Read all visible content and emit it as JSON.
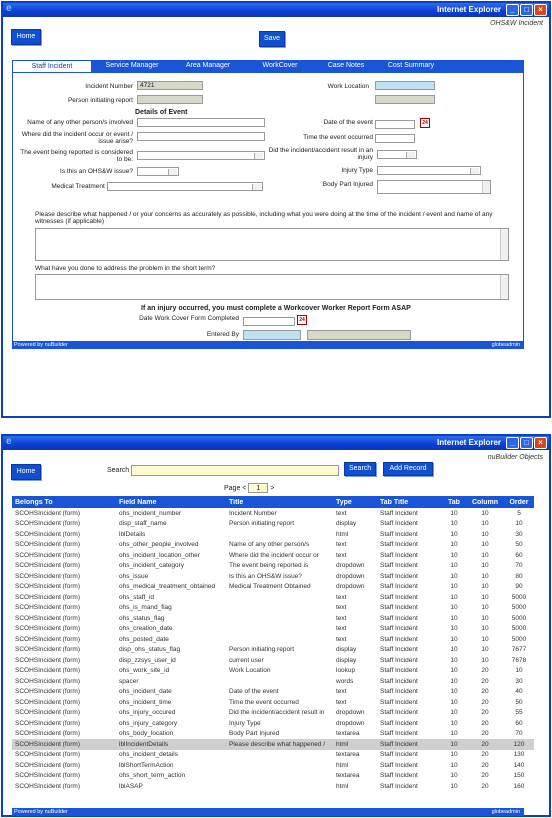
{
  "win1": {
    "title": "Internet Explorer",
    "subtitle": "OHS&W Incident",
    "home": "Home",
    "save": "Save",
    "tabs": [
      "Staff Incident",
      "Service Manager",
      "Area Manager",
      "WorkCover",
      "Case Notes",
      "Cost Summary"
    ],
    "incident_number_label": "Incident Number",
    "incident_number_value": "4721",
    "person_initiating_label": "Person initiating report",
    "details_heading": "Details of Event",
    "work_location_label": "Work Location",
    "other_persons_label": "Name of any other person/s involved",
    "where_label": "Where did the incident occur or event / issue arise?",
    "category_label": "The event being reported is considered to be:",
    "ohsw_label": "Is this an OHS&W issue?",
    "medical_label": "Medical Treatment Obtained",
    "date_label": "Date of the event",
    "time_label": "Time the event occurred",
    "injury_result_label": "Did the incident/accident result in an injury",
    "injury_type_label": "Injury Type",
    "body_part_label": "Body Part Injured",
    "describe_label": "Please describe what happened / or your concerns as accurately as possible, including what you were doing at the time of the incident / event and name of any witnesses (if applicable)",
    "short_term_label": "What have you done to address the problem in the short term?",
    "asap_heading": "If an injury occurred, you must complete a Workcover Worker Report Form ASAP",
    "workcover_date_label": "Date Work Cover Form Completed",
    "entered_by_label": "Entered By",
    "calendar_text": "24",
    "footer_left": "Powered by nuBuilder",
    "footer_right": "globeadmin"
  },
  "win2": {
    "title": "Internet Explorer",
    "subtitle": "nuBuilder Objects",
    "home": "Home",
    "search_label": "Search",
    "search_value": "",
    "search_button": "Search",
    "add_button": "Add Record",
    "page_label": "Page <",
    "page_value": "1",
    "page_next": ">",
    "columns": [
      "Belongs To",
      "Field Name",
      "Title",
      "Type",
      "Tab Title",
      "Tab",
      "Column",
      "Order"
    ],
    "rows": [
      [
        "SCOHSIncident (form)",
        "ohs_incident_number",
        "Incident Number",
        "text",
        "Staff Incident",
        "10",
        "10",
        "5"
      ],
      [
        "SCOHSIncident (form)",
        "disp_staff_name",
        "Person initiating report",
        "display",
        "Staff Incident",
        "10",
        "10",
        "10"
      ],
      [
        "SCOHSIncident (form)",
        "lblDetails",
        "",
        "html",
        "Staff Incident",
        "10",
        "10",
        "30"
      ],
      [
        "SCOHSIncident (form)",
        "ohs_other_people_involved",
        "Name of any other person/s",
        "text",
        "Staff Incident",
        "10",
        "10",
        "50"
      ],
      [
        "SCOHSIncident (form)",
        "ohs_incident_location_other",
        "Where did the incident occur or",
        "text",
        "Staff Incident",
        "10",
        "10",
        "60"
      ],
      [
        "SCOHSIncident (form)",
        "ohs_incident_category",
        "The event being reported is",
        "dropdown",
        "Staff Incident",
        "10",
        "10",
        "70"
      ],
      [
        "SCOHSIncident (form)",
        "ohs_issue",
        "Is this an OHS&W issue?",
        "dropdown",
        "Staff Incident",
        "10",
        "10",
        "80"
      ],
      [
        "SCOHSIncident (form)",
        "ohs_medical_treatment_obtained",
        "Medical Treatment Obtained",
        "dropdown",
        "Staff Incident",
        "10",
        "10",
        "90"
      ],
      [
        "SCOHSIncident (form)",
        "ohs_staff_id",
        "",
        "text",
        "Staff Incident",
        "10",
        "10",
        "5000"
      ],
      [
        "SCOHSIncident (form)",
        "ohs_is_mand_flag",
        "",
        "text",
        "Staff Incident",
        "10",
        "10",
        "5000"
      ],
      [
        "SCOHSIncident (form)",
        "ohs_status_flag",
        "",
        "text",
        "Staff Incident",
        "10",
        "10",
        "5000"
      ],
      [
        "SCOHSIncident (form)",
        "ohs_creation_date",
        "",
        "text",
        "Staff Incident",
        "10",
        "10",
        "5000"
      ],
      [
        "SCOHSIncident (form)",
        "ohs_posted_date",
        "",
        "text",
        "Staff Incident",
        "10",
        "10",
        "5000"
      ],
      [
        "SCOHSIncident (form)",
        "disp_ohs_status_flag",
        "Person initiating report",
        "display",
        "Staff Incident",
        "10",
        "10",
        "7677"
      ],
      [
        "SCOHSIncident (form)",
        "disp_zzsys_user_id",
        "current user",
        "display",
        "Staff Incident",
        "10",
        "10",
        "7678"
      ],
      [
        "SCOHSIncident (form)",
        "ohs_work_site_id",
        "Work Location",
        "lookup",
        "Staff Incident",
        "10",
        "20",
        "10"
      ],
      [
        "SCOHSIncident (form)",
        "spacer",
        "",
        "words",
        "Staff Incident",
        "10",
        "20",
        "30"
      ],
      [
        "SCOHSIncident (form)",
        "ohs_incident_date",
        "Date of the event",
        "text",
        "Staff Incident",
        "10",
        "20",
        "40"
      ],
      [
        "SCOHSIncident (form)",
        "ohs_incident_time",
        "Time the event occurred",
        "text",
        "Staff Incident",
        "10",
        "20",
        "50"
      ],
      [
        "SCOHSIncident (form)",
        "ohs_injury_occured",
        "Did the incident/accident result in",
        "dropdown",
        "Staff Incident",
        "10",
        "20",
        "55"
      ],
      [
        "SCOHSIncident (form)",
        "ohs_injury_category",
        "Injury Type",
        "dropdown",
        "Staff Incident",
        "10",
        "20",
        "60"
      ],
      [
        "SCOHSIncident (form)",
        "ohs_body_location",
        "Body Part Injured",
        "textarea",
        "Staff Incident",
        "10",
        "20",
        "70"
      ],
      [
        "SCOHSIncident (form)",
        "lblIncidentDetails",
        "Please describe what happened /",
        "html",
        "Staff Incident",
        "10",
        "20",
        "120"
      ],
      [
        "SCOHSIncident (form)",
        "ohs_incident_details",
        "",
        "textarea",
        "Staff Incident",
        "10",
        "20",
        "130"
      ],
      [
        "SCOHSIncident (form)",
        "lblShortTermAction",
        "",
        "html",
        "Staff Incident",
        "10",
        "20",
        "140"
      ],
      [
        "SCOHSIncident (form)",
        "ohs_short_term_action",
        "",
        "textarea",
        "Staff Incident",
        "10",
        "20",
        "150"
      ],
      [
        "SCOHSIncident (form)",
        "lblASAP",
        "",
        "html",
        "Staff Incident",
        "10",
        "20",
        "160"
      ]
    ],
    "selected_row": 22,
    "footer_left": "Powered by nuBuilder",
    "footer_right": "globeadmin"
  }
}
